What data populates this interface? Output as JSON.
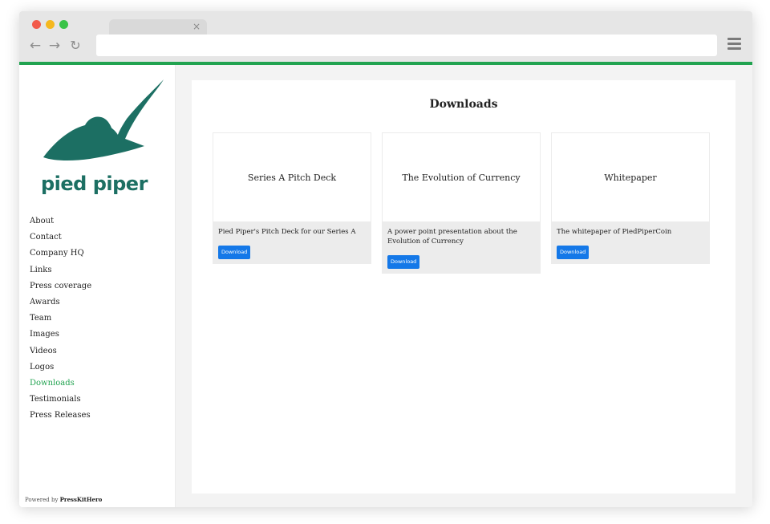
{
  "browser": {
    "tab_close": "×",
    "back_glyph": "←",
    "forward_glyph": "→",
    "reload_glyph": "↻"
  },
  "brand": {
    "logo_text": "pied piper",
    "color": "#1c6f63",
    "accent": "#21a350"
  },
  "sidebar": {
    "items": [
      {
        "label": "About"
      },
      {
        "label": "Contact"
      },
      {
        "label": "Company HQ"
      },
      {
        "label": "Links"
      },
      {
        "label": "Press coverage"
      },
      {
        "label": "Awards"
      },
      {
        "label": "Team"
      },
      {
        "label": "Images"
      },
      {
        "label": "Videos"
      },
      {
        "label": "Logos"
      },
      {
        "label": "Downloads",
        "active": true
      },
      {
        "label": "Testimonials"
      },
      {
        "label": "Press Releases"
      }
    ],
    "powered_prefix": "Powered by",
    "powered_brand": "PressKitHero"
  },
  "main": {
    "title": "Downloads",
    "cards": [
      {
        "title": "Series A Pitch Deck",
        "description": "Pied Piper's Pitch Deck for our Series A",
        "button": "Download"
      },
      {
        "title": "The Evolution of Currency",
        "description": "A power point presentation about the Evolution of Currency",
        "button": "Download"
      },
      {
        "title": "Whitepaper",
        "description": "The whitepaper of PiedPiperCoin",
        "button": "Download"
      }
    ]
  }
}
